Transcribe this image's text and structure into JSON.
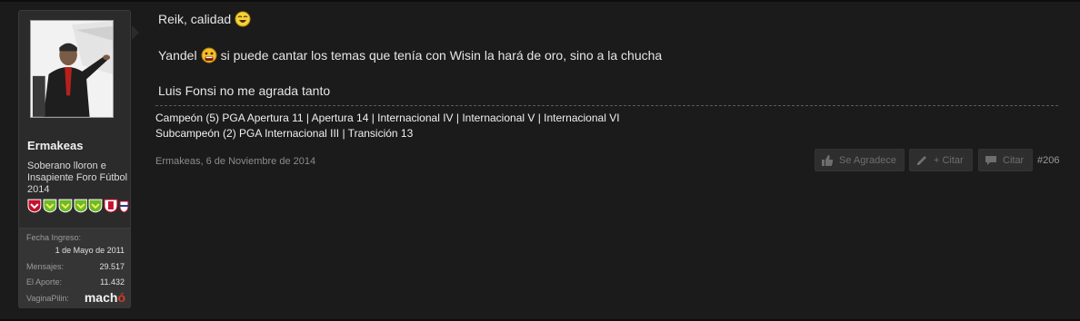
{
  "post": {
    "author": "Ermakeas",
    "author_title": "Soberano lloron e Insapiente Foro Fútbol 2014",
    "date_line": "Ermakeas, 6 de Noviembre de 2014",
    "number": "#206",
    "message": {
      "line1": "Reik, calidad",
      "line2_a": "Yandel",
      "line2_b": "si puede cantar los temas que tenía con Wisin la hará de oro, sino a la chucha",
      "line3": "Luis Fonsi no me agrada tanto"
    },
    "signature": {
      "line1": "Campeón (5) PGA Apertura 11 | Apertura 14 | Internacional IV | Internacional V | Internacional VI",
      "line2": "Subcampeón (2) PGA Internacional III | Transición 13"
    }
  },
  "stats": {
    "joined_label": "Fecha Ingreso:",
    "joined_value": "1 de Mayo de 2011",
    "posts_label": "Mensajes:",
    "posts_value": "29.517",
    "aporte_label": "El Aporte:",
    "aporte_value": "11.432",
    "vp_label": "VaginaPilin:",
    "vp_logo_main": "mach",
    "vp_logo_accent": "ó"
  },
  "actions": {
    "thanks": "Se Agradece",
    "multiquote": "+ Citar",
    "quote": "Citar"
  },
  "colors": {
    "background": "#1b1b1b",
    "panel": "#2b2b2b",
    "badge_green": "#6fb82a",
    "badge_red": "#c8102e",
    "logo_accent": "#d23b2a"
  },
  "icons": [
    "thumbs-up-icon",
    "pencil-icon",
    "speech-bubble-icon",
    "laugh-emoji-icon",
    "scream-emoji-icon"
  ]
}
